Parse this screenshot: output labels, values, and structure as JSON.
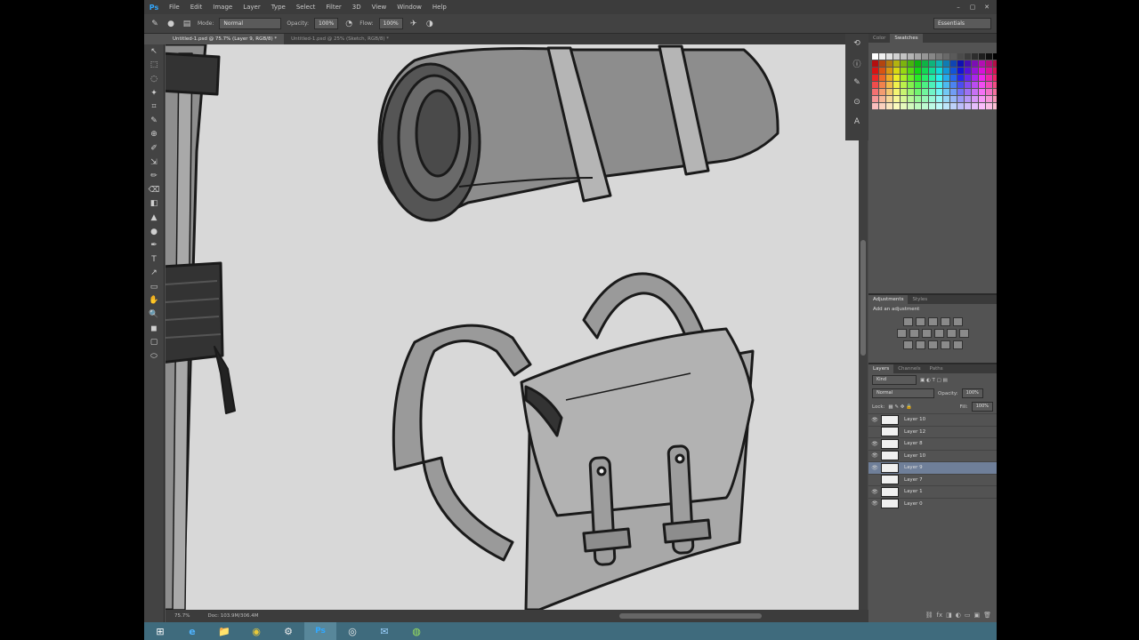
{
  "menubar": {
    "app_logo": "Ps",
    "items": [
      "File",
      "Edit",
      "Image",
      "Layer",
      "Type",
      "Select",
      "Filter",
      "3D",
      "View",
      "Window",
      "Help"
    ],
    "window_controls": [
      "–",
      "▢",
      "✕"
    ]
  },
  "options": {
    "mode_label": "Mode:",
    "mode_value": "Normal",
    "opacity_label": "Opacity:",
    "opacity_value": "100%",
    "flow_label": "Flow:",
    "flow_value": "100%",
    "workspace": "Essentials"
  },
  "tabs": [
    {
      "label": "Untitled-1.psd @ 75.7% (Layer 9, RGB/8) *",
      "active": true
    },
    {
      "label": "Untitled-1.psd @ 25% (Sketch, RGB/8) *",
      "active": false
    }
  ],
  "tools": [
    "↖",
    "⬚",
    "◌",
    "✦",
    "⌗",
    "✎",
    "⊕",
    "✐",
    "⇲",
    "✏",
    "⌫",
    "◧",
    "▲",
    "●",
    "✒",
    "T",
    "↗",
    "▭",
    "✋",
    "🔍",
    "◼",
    "▢",
    "⬭"
  ],
  "status": {
    "zoom": "75.7%",
    "doc": "Doc: 103.9M/306.4M"
  },
  "panels": {
    "color_tabs": [
      "Color",
      "Swatches"
    ],
    "adjustments_tabs": [
      "Adjustments",
      "Styles"
    ],
    "adjustments_title": "Add an adjustment",
    "layers_tabs": [
      "Layers",
      "Channels",
      "Paths"
    ],
    "kind_label": "Kind",
    "blend_mode": "Normal",
    "opacity_label": "Opacity:",
    "opacity_value": "100%",
    "lock_label": "Lock:",
    "fill_label": "Fill:",
    "fill_value": "100%"
  },
  "layers": [
    {
      "name": "Layer 10",
      "visible": true,
      "selected": false
    },
    {
      "name": "Layer 12",
      "visible": false,
      "selected": false
    },
    {
      "name": "Layer 8",
      "visible": true,
      "selected": false
    },
    {
      "name": "Layer 10",
      "visible": true,
      "selected": false
    },
    {
      "name": "Layer 9",
      "visible": true,
      "selected": true
    },
    {
      "name": "Layer 7",
      "visible": false,
      "selected": false
    },
    {
      "name": "Layer 1",
      "visible": true,
      "selected": false
    },
    {
      "name": "Layer 0",
      "visible": true,
      "selected": false
    }
  ],
  "taskbar": [
    "⊞",
    "e",
    "📁",
    "◉",
    "⚙",
    "Ps",
    "◎",
    "✉",
    "◍"
  ],
  "colors": {
    "accent": "#31a8ff",
    "selected_layer": "#6f7f99",
    "taskbar": "#3f6b7d"
  }
}
